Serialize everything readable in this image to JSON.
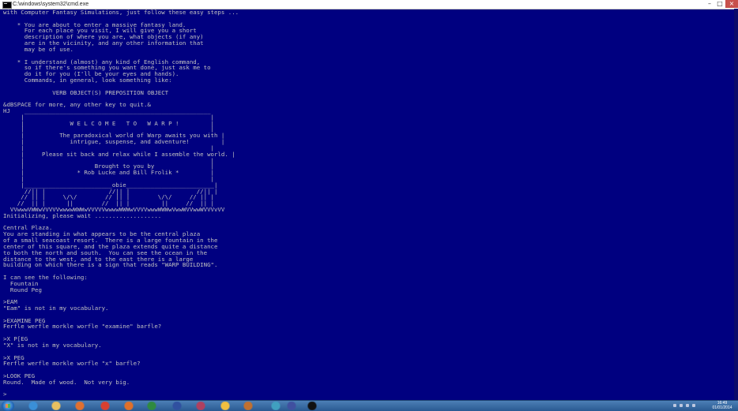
{
  "window": {
    "title": "C:\\windows\\system32\\cmd.exe",
    "min_label": "–",
    "max_label": "□",
    "close_label": "×"
  },
  "colors": {
    "console_bg": "#000080",
    "console_fg": "#c0c0c0",
    "taskbar": "#2f6aa6"
  },
  "console": {
    "lines": [
      "with Computer Fantasy Simulations, just follow these easy steps ...",
      "",
      "    * You are about to enter a massive fantasy land.",
      "      For each place you visit, I will give you a short",
      "      description of where you are, what objects (if any)",
      "      are in the vicinity, and any other information that",
      "      may be of use.",
      "",
      "    * I understand (almost) any kind of English command,",
      "      so if there's something you want done, just ask me to",
      "      do it for you (I'll be your eyes and hands).",
      "      Commands, in general, look something like:",
      "",
      "              VERB OBJECT(S) PREPOSITION OBJECT",
      "",
      "&dBSPACE for more, any other key to quit.&",
      "HJ    _____________________________________________________",
      "     |                                                     |",
      "     |             W E L C O M E   T O   W A R P !         |",
      "     |                                                     |",
      "     |          The paradoxical world of Warp awaits you with |",
      "     |             intrigue, suspense, and adventure!         |",
      "     |                                                     |",
      "     |     Please sit back and relax while I assemble the world. |",
      "     |                                                     |",
      "     |                    Brought to you by                |",
      "     |               * Rob Lucke and Bill Frolik *         |",
      "     |                                                     |",
      "     |_________________________obie_________________________|",
      "      //|| |                  //|| |                   //|| |",
      "     // || |     \\/\\/        // || |        \\/\\/     // || |",
      "    //  || |      ||        //  || |         ||     //  || |",
      "  VVwwwVWWwVVVVVwwwwWWWwVVVVVwwwwWWWwVVVVwwwWWWwVwwWVVwwWVVVvVV",
      "Initializing, please wait ...................",
      "",
      "Central Plaza.",
      "You are standing in what appears to be the central plaza",
      "of a small seacoast resort.  There is a large fountain in the",
      "center of this square, and the plaza extends quite a distance",
      "to both the north and south.  You can see the ocean in the",
      "distance to the west, and to the east there is a large",
      "building on which there is a sign that reads \"WARP BUILDING\".",
      "",
      "I can see the following:",
      "  Fountain",
      "  Round Peg",
      "",
      ">EAM",
      "\"Eam\" is not in my vocabulary.",
      "",
      ">EXAMINE PEG",
      "Ferfle werfle morkle worfle \"examine\" barfle?",
      "",
      ">X P[EG",
      "\"X\" is not in my vocabulary.",
      "",
      ">X PEG",
      "Ferfle werfle morkle worfle \"x\" barfle?",
      "",
      ">LOOK PEG",
      "Round.  Made of wood.  Not very big.",
      "",
      ">"
    ]
  },
  "taskbar": {
    "icons": [
      {
        "name": "ie-icon",
        "color": "#3a8fd8"
      },
      {
        "name": "explorer-icon",
        "color": "#e8c060"
      },
      {
        "name": "media-player-icon",
        "color": "#e07030"
      },
      {
        "name": "chrome-icon",
        "color": "#d94030"
      },
      {
        "name": "firefox-icon",
        "color": "#e0702a"
      },
      {
        "name": "excel-icon",
        "color": "#2f8a40"
      },
      {
        "name": "word-icon",
        "color": "#3050a0"
      },
      {
        "name": "photo-icon",
        "color": "#b04060"
      },
      {
        "name": "folder-icon",
        "color": "#f0c040"
      },
      {
        "name": "game-icon",
        "color": "#c07030"
      },
      {
        "name": "app-icon",
        "color": "#40a0c0"
      },
      {
        "name": "network-app-icon",
        "color": "#4050a0"
      },
      {
        "name": "cmd-icon",
        "color": "#111111"
      }
    ],
    "clock_time": "16:49",
    "clock_date": "01/01/2014"
  }
}
